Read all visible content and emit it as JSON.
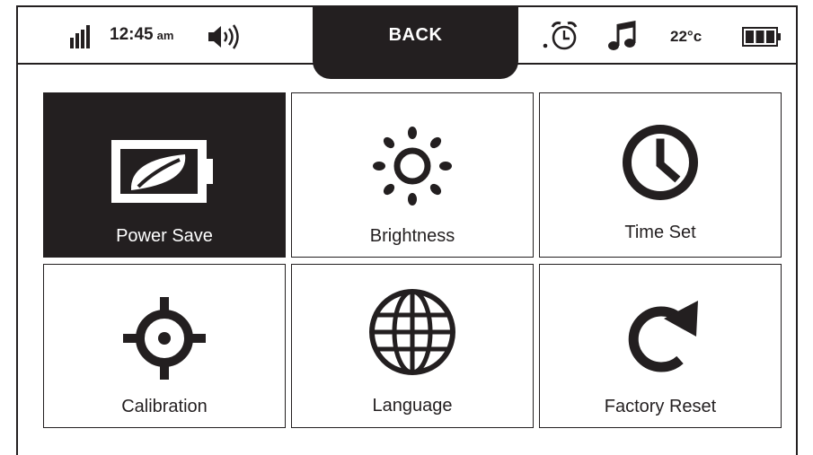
{
  "status_bar": {
    "clock_time": "12:45",
    "clock_suffix": "am",
    "temperature": "22°c",
    "battery_level": 1.0,
    "icons": [
      "signal-bars-icon",
      "speaker-volume-icon",
      "alarm-clock-icon",
      "music-note-icon",
      "battery-icon"
    ]
  },
  "back_tab": {
    "label": "BACK"
  },
  "menu": {
    "tiles": [
      {
        "label": "Power Save",
        "icon": "battery-leaf-icon",
        "selected": true
      },
      {
        "label": "Brightness",
        "icon": "sun-icon",
        "selected": false
      },
      {
        "label": "Time Set",
        "icon": "clock-icon",
        "selected": false
      },
      {
        "label": "Calibration",
        "icon": "crosshair-icon",
        "selected": false
      },
      {
        "label": "Language",
        "icon": "globe-icon",
        "selected": false
      },
      {
        "label": "Factory Reset",
        "icon": "reset-arrow-icon",
        "selected": false
      }
    ]
  },
  "colors": {
    "ink": "#231f20",
    "background": "#ffffff",
    "selected_tile": "#231f20"
  }
}
